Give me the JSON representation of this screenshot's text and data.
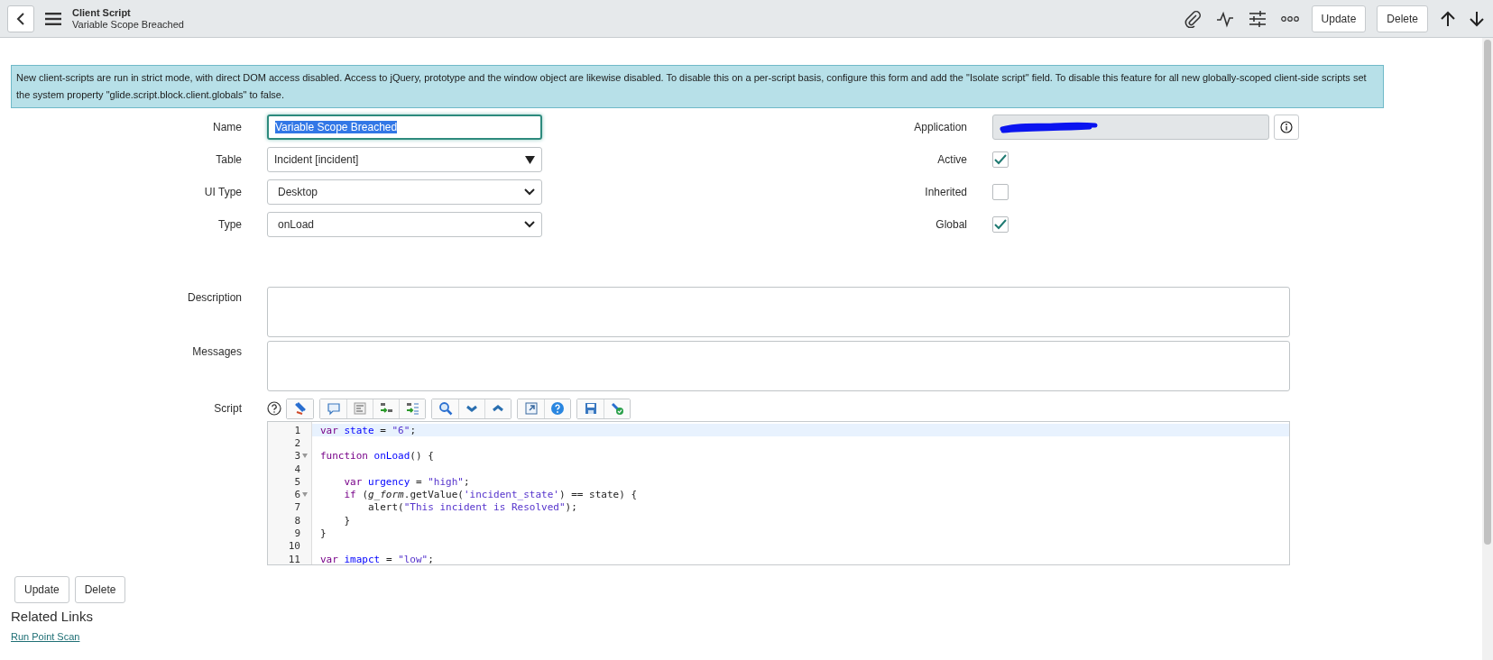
{
  "header": {
    "title": "Client Script",
    "subtitle": "Variable Scope Breached",
    "buttons": [
      "Update",
      "Delete"
    ]
  },
  "notice": "New client-scripts are run in strict mode, with direct DOM access disabled. Access to jQuery, prototype and the window object are likewise disabled. To disable this on a per-script basis, configure this form and add the \"Isolate script\" field. To disable this feature for all new globally-scoped client-side scripts set the system property \"glide.script.block.client.globals\" to false.",
  "left_fields": [
    {
      "label": "Name",
      "kind": "text",
      "value": "Variable Scope Breached",
      "selected": true
    },
    {
      "label": "Table",
      "kind": "reference",
      "value": "Incident [incident]",
      "selected": false
    },
    {
      "label": "UI Type",
      "kind": "select",
      "value": "Desktop",
      "selected": false
    },
    {
      "label": "Type",
      "kind": "select",
      "value": "onLoad",
      "selected": false
    }
  ],
  "right_fields": [
    {
      "label": "Application",
      "kind": "readonly",
      "redacted": true
    },
    {
      "label": "Active",
      "kind": "checkbox",
      "checked": true
    },
    {
      "label": "Inherited",
      "kind": "checkbox",
      "checked": false
    },
    {
      "label": "Global",
      "kind": "checkbox",
      "checked": true
    }
  ],
  "text_areas": [
    {
      "label": "Description"
    },
    {
      "label": "Messages"
    }
  ],
  "script": {
    "label": "Script",
    "lines": [
      {
        "num": "1",
        "fold": false,
        "selected": true,
        "text": "var state = \"6\";"
      },
      {
        "num": "2",
        "fold": false,
        "selected": false
      },
      {
        "num": "3",
        "fold": true,
        "selected": false,
        "text": "function onLoad() {"
      },
      {
        "num": "4",
        "fold": false,
        "selected": false
      },
      {
        "num": "5",
        "fold": false,
        "selected": false,
        "text": "    var urgency = \"high\";"
      },
      {
        "num": "6",
        "fold": true,
        "selected": false,
        "text": "    if (g_form.getValue('incident_state') == state) {"
      },
      {
        "num": "7",
        "fold": false,
        "selected": false,
        "text": "        alert(\"This incident is Resolved\");"
      },
      {
        "num": "8",
        "fold": false,
        "selected": false,
        "text": "    }"
      },
      {
        "num": "9",
        "fold": false,
        "selected": false,
        "text": "}"
      },
      {
        "num": "10",
        "fold": false,
        "selected": false
      },
      {
        "num": "11",
        "fold": false,
        "selected": false,
        "text": "var imapct = \"low\";"
      }
    ]
  },
  "bottom_buttons": [
    "Update",
    "Delete"
  ],
  "related_links": {
    "title": "Related Links",
    "links": [
      "Run Point Scan"
    ]
  }
}
